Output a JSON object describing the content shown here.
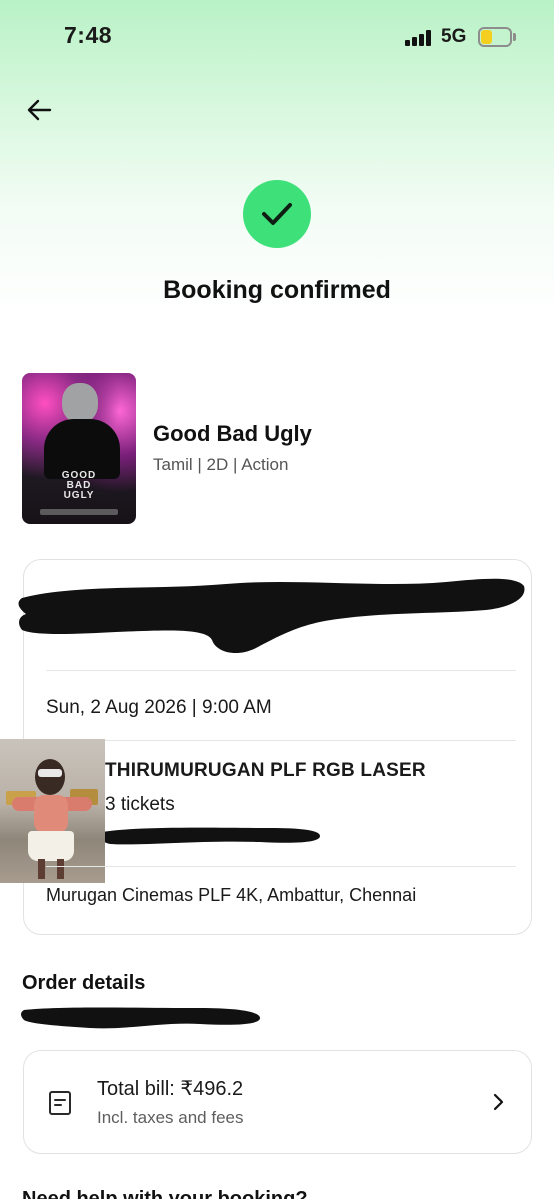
{
  "status_bar": {
    "time": "7:48",
    "network": "5G",
    "battery_level": 0.3
  },
  "header": {
    "back_icon": "arrow-left-icon"
  },
  "confirmation": {
    "icon": "check-icon",
    "title": "Booking confirmed",
    "accent": "#3ee07a"
  },
  "movie": {
    "title": "Good Bad Ugly",
    "meta": "Tamil | 2D | Action",
    "poster_logo": "GOOD BAD UGLY"
  },
  "booking": {
    "datetime": "Sun, 2 Aug 2026 | 9:00 AM",
    "screen": "THIRUMURUGAN PLF RGB LASER",
    "tickets": "3 tickets",
    "venue": "Murugan Cinemas PLF 4K, Ambattur, Chennai"
  },
  "order": {
    "section_title": "Order details",
    "total_bill": "Total bill: ₹496.2",
    "bill_note": "Incl. taxes and fees",
    "bill_icon": "receipt-icon",
    "chevron_icon": "chevron-right-icon"
  },
  "footer": {
    "partial_text": "Need help with your booking?"
  }
}
